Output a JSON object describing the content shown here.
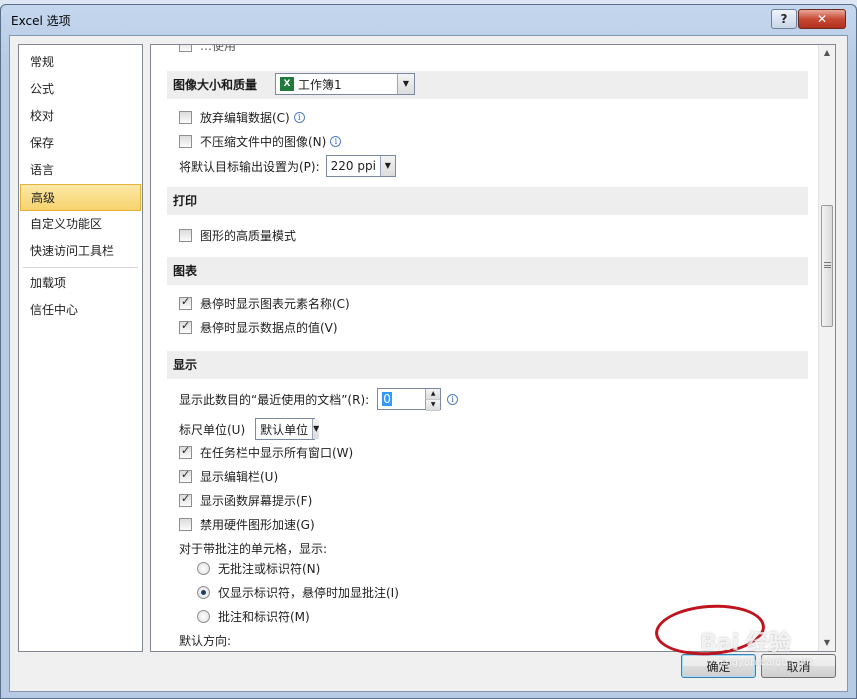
{
  "window": {
    "title": "Excel 选项",
    "help_label": "?",
    "close_label": "✕"
  },
  "nav": {
    "items": [
      {
        "label": "常规"
      },
      {
        "label": "公式"
      },
      {
        "label": "校对"
      },
      {
        "label": "保存"
      },
      {
        "label": "语言"
      },
      {
        "label": "高级",
        "selected": true
      },
      {
        "label": "自定义功能区"
      },
      {
        "label": "快速访问工具栏"
      },
      {
        "label": "加载项"
      },
      {
        "label": "信任中心"
      }
    ]
  },
  "content": {
    "cut_text": "…使用",
    "image_size": {
      "label": "图像大小和质量",
      "workbook_value": "工作簿1",
      "workbook_icon": "X",
      "discard_edit": {
        "label": "放弃编辑数据(C)",
        "checked": false
      },
      "no_compress": {
        "label": "不压缩文件中的图像(N)",
        "checked": false
      },
      "default_target_label": "将默认目标输出设置为(P):",
      "default_target_value": "220 ppi"
    },
    "print": {
      "label": "打印",
      "high_quality": {
        "label": "图形的高质量模式",
        "checked": false
      }
    },
    "chart": {
      "label": "图表",
      "show_element_names": {
        "label": "悬停时显示图表元素名称(C)",
        "checked": true
      },
      "show_point_values": {
        "label": "悬停时显示数据点的值(V)",
        "checked": true
      }
    },
    "display": {
      "label": "显示",
      "recent_docs_label": "显示此数目的“最近使用的文档”(R):",
      "recent_docs_value": "0",
      "ruler_label": "标尺单位(U)",
      "ruler_value": "默认单位",
      "show_all_windows": {
        "label": "在任务栏中显示所有窗口(W)",
        "checked": true
      },
      "show_formula_bar": {
        "label": "显示编辑栏(U)",
        "checked": true
      },
      "show_func_tips": {
        "label": "显示函数屏幕提示(F)",
        "checked": true
      },
      "disable_hw_accel": {
        "label": "禁用硬件图形加速(G)",
        "checked": false
      },
      "comments_label": "对于带批注的单元格，显示:",
      "radio_none": {
        "label": "无批注或标识符(N)",
        "checked": false
      },
      "radio_indicator": {
        "label": "仅显示标识符，悬停时加显批注(I)",
        "checked": true
      },
      "radio_both": {
        "label": "批注和标识符(M)",
        "checked": false
      },
      "direction_label": "默认方向:"
    }
  },
  "footer": {
    "ok_label": "确定",
    "cancel_label": "取消"
  },
  "watermark": {
    "text": "Bai 经验",
    "sub": "jingyan.baidu.com"
  },
  "colors": {
    "selected_nav": "#f7d36d",
    "annotation": "#c0131d"
  }
}
